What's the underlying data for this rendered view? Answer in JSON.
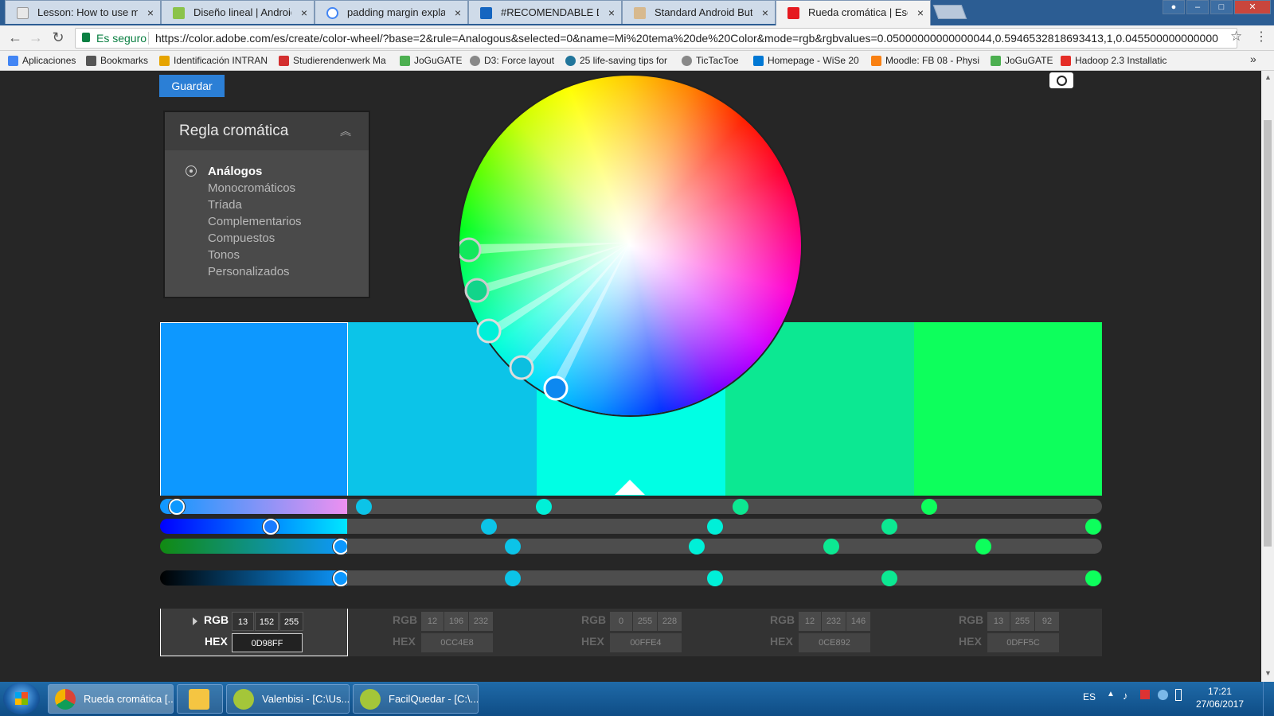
{
  "browser": {
    "tabs": [
      {
        "title": "Lesson: How to use marg",
        "icon_color": "#e8e8e8"
      },
      {
        "title": "Diseño lineal | Android D",
        "icon_color": "#8bc34a"
      },
      {
        "title": "padding margin explaine",
        "icon_color": "#4285f4"
      },
      {
        "title": "#RECOMENDABLE Defini",
        "icon_color": "#1565c0"
      },
      {
        "title": "Standard Android Button",
        "icon_color": "#d7b98e"
      },
      {
        "title": "Rueda cromática | Esque",
        "icon_color": "#e5191f"
      }
    ],
    "close_glyph": "×",
    "window_buttons": {
      "minimize": "–",
      "maximize": "□",
      "close": "✕"
    },
    "secure_label": "Es seguro",
    "url": "https://color.adobe.com/es/create/color-wheel/?base=2&rule=Analogous&selected=0&name=Mi%20tema%20de%20Color&mode=rgb&rgbvalues=0.05000000000000044,0.5946532818693413,1,0.045500000000000",
    "bookmarks": [
      {
        "label": "Aplicaciones",
        "icon_color": "#4285f4"
      },
      {
        "label": "Bookmarks",
        "icon_color": "#555555"
      },
      {
        "label": "Identificación INTRAN",
        "icon_color": "#e6a400"
      },
      {
        "label": "Studierendenwerk Ma",
        "icon_color": "#d32f2f"
      },
      {
        "label": "JoGuGATE",
        "icon_color": "#4caf50"
      },
      {
        "label": "D3: Force layout",
        "icon_color": "#888888"
      },
      {
        "label": "25 life-saving tips for",
        "icon_color": "#21759b"
      },
      {
        "label": "TicTacToe",
        "icon_color": "#888888"
      },
      {
        "label": "Homepage - WiSe 20",
        "icon_color": "#0078d4"
      },
      {
        "label": "Moodle: FB 08 - Physi",
        "icon_color": "#f98012"
      },
      {
        "label": "JoGuGATE",
        "icon_color": "#4caf50"
      },
      {
        "label": "Hadoop 2.3 Installatic",
        "icon_color": "#e52d27"
      }
    ],
    "more_bookmarks": "»"
  },
  "page": {
    "save_label": "Guardar",
    "rule_panel": {
      "title": "Regla cromática",
      "collapse_glyph": "︽",
      "options": [
        "Análogos",
        "Monocromáticos",
        "Tríada",
        "Complementarios",
        "Compuestos",
        "Tonos",
        "Personalizados"
      ],
      "selected": "Análogos"
    },
    "swatches": [
      {
        "hex": "0D98FF",
        "rgb": [
          "13",
          "152",
          "255"
        ],
        "color": "#0d98ff",
        "selected": true
      },
      {
        "hex": "0CC4E8",
        "rgb": [
          "12",
          "196",
          "232"
        ],
        "color": "#0cc4e8",
        "selected": false
      },
      {
        "hex": "00FFE4",
        "rgb": [
          "0",
          "255",
          "228"
        ],
        "color": "#00ffe4",
        "selected": false
      },
      {
        "hex": "0CE892",
        "rgb": [
          "12",
          "232",
          "146"
        ],
        "color": "#0ce892",
        "selected": false
      },
      {
        "hex": "0DFF5C",
        "rgb": [
          "13",
          "255",
          "92"
        ],
        "color": "#0dff5c",
        "selected": false
      }
    ],
    "rgb_label": "RGB",
    "hex_label": "HEX"
  },
  "taskbar": {
    "items": [
      {
        "label": "Rueda cromática [...",
        "icon_color": "#ffcd40",
        "active": true
      },
      {
        "label": "",
        "icon_color": "#f5c542",
        "active": false
      },
      {
        "label": "Valenbisi - [C:\\Us...",
        "icon_color": "#a4c639",
        "active": false
      },
      {
        "label": "FacilQuedar - [C:\\...",
        "icon_color": "#a4c639",
        "active": false
      }
    ],
    "language": "ES",
    "time": "17:21",
    "date": "27/06/2017"
  }
}
